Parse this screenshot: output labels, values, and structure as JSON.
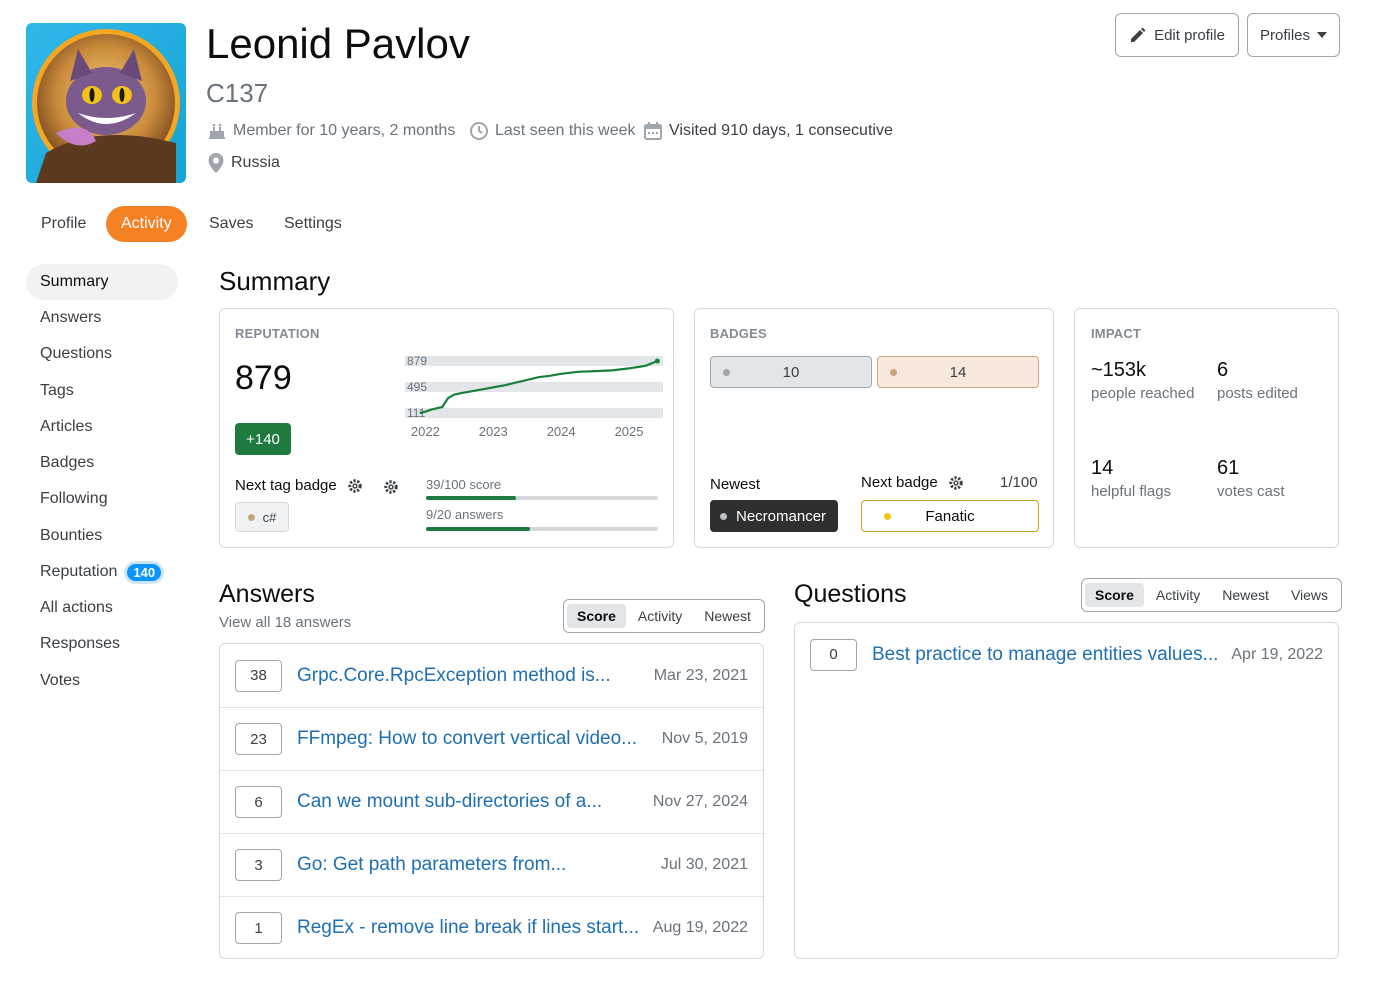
{
  "user": {
    "name": "Leonid Pavlov",
    "handle": "C137",
    "member_for": "Member for 10 years, 2 months",
    "last_seen": "Last seen this week",
    "visited": "Visited 910 days, 1 consecutive",
    "location": "Russia"
  },
  "actions": {
    "edit_profile": "Edit profile",
    "profiles": "Profiles"
  },
  "tabs": [
    {
      "label": "Profile"
    },
    {
      "label": "Activity"
    },
    {
      "label": "Saves"
    },
    {
      "label": "Settings"
    }
  ],
  "sidebar": {
    "items": [
      {
        "label": "Summary"
      },
      {
        "label": "Answers"
      },
      {
        "label": "Questions"
      },
      {
        "label": "Tags"
      },
      {
        "label": "Articles"
      },
      {
        "label": "Badges"
      },
      {
        "label": "Following"
      },
      {
        "label": "Bounties"
      },
      {
        "label": "Reputation",
        "badge": "140"
      },
      {
        "label": "All actions"
      },
      {
        "label": "Responses"
      },
      {
        "label": "Votes"
      }
    ]
  },
  "summary": {
    "title": "Summary",
    "reputation": {
      "label": "REPUTATION",
      "value": "879",
      "delta": "+140",
      "next_tag_badge": "Next tag badge",
      "tag": "c#",
      "progress1_label": "39/100 score",
      "progress1": 0.39,
      "progress2_label": "9/20 answers",
      "progress2": 0.45,
      "chart_y_ticks": [
        "879",
        "495",
        "111"
      ],
      "chart_x_ticks": [
        "2022",
        "2023",
        "2024",
        "2025"
      ]
    },
    "badges": {
      "label": "BADGES",
      "silver": "10",
      "bronze": "14",
      "newest_label": "Newest",
      "newest": "Necromancer",
      "next_badge_label": "Next badge",
      "next_progress": "1/100",
      "next_badge": "Fanatic"
    },
    "impact": {
      "label": "IMPACT",
      "people_reached_value": "~153k",
      "people_reached_label": "people reached",
      "posts_edited_value": "6",
      "posts_edited_label": "posts edited",
      "helpful_flags_value": "14",
      "helpful_flags_label": "helpful flags",
      "votes_cast_value": "61",
      "votes_cast_label": "votes cast"
    }
  },
  "answers": {
    "title": "Answers",
    "subtitle": "View all 18 answers",
    "sorts": [
      "Score",
      "Activity",
      "Newest"
    ],
    "items": [
      {
        "score": "38",
        "title": "Grpc.Core.RpcException method is...",
        "date": "Mar 23, 2021"
      },
      {
        "score": "23",
        "title": "FFmpeg: How to convert vertical video...",
        "date": "Nov 5, 2019"
      },
      {
        "score": "6",
        "title": "Can we mount sub-directories of a...",
        "date": "Nov 27, 2024"
      },
      {
        "score": "3",
        "title": "Go: Get path parameters from...",
        "date": "Jul 30, 2021"
      },
      {
        "score": "1",
        "title": "RegEx - remove line break if lines start...",
        "date": "Aug 19, 2022"
      }
    ]
  },
  "questions": {
    "title": "Questions",
    "sorts": [
      "Score",
      "Activity",
      "Newest",
      "Views"
    ],
    "items": [
      {
        "score": "0",
        "title": "Best practice to manage entities values...",
        "date": "Apr 19, 2022"
      }
    ]
  },
  "chart_data": {
    "type": "line",
    "title": "",
    "x": [
      "2021-12",
      "2022-01",
      "2022-02",
      "2022-03",
      "2022-04",
      "2022-05",
      "2022-06",
      "2022-07",
      "2022-09",
      "2022-11",
      "2023-01",
      "2023-03",
      "2023-05",
      "2023-07",
      "2023-09",
      "2023-11",
      "2024-01",
      "2024-04",
      "2024-07",
      "2024-10",
      "2025-01",
      "2025-04",
      "2025-06"
    ],
    "series": [
      {
        "values": [
          111,
          130,
          160,
          180,
          200,
          330,
          380,
          400,
          430,
          460,
          490,
          520,
          560,
          600,
          640,
          660,
          690,
          720,
          730,
          740,
          770,
          810,
          879
        ]
      }
    ],
    "y_ticks": [
      879,
      495,
      111
    ],
    "x_ticks": [
      "2022",
      "2023",
      "2024",
      "2025"
    ],
    "ylim": [
      111,
      879
    ],
    "colors": {
      "line": "#1a7f3c"
    }
  }
}
